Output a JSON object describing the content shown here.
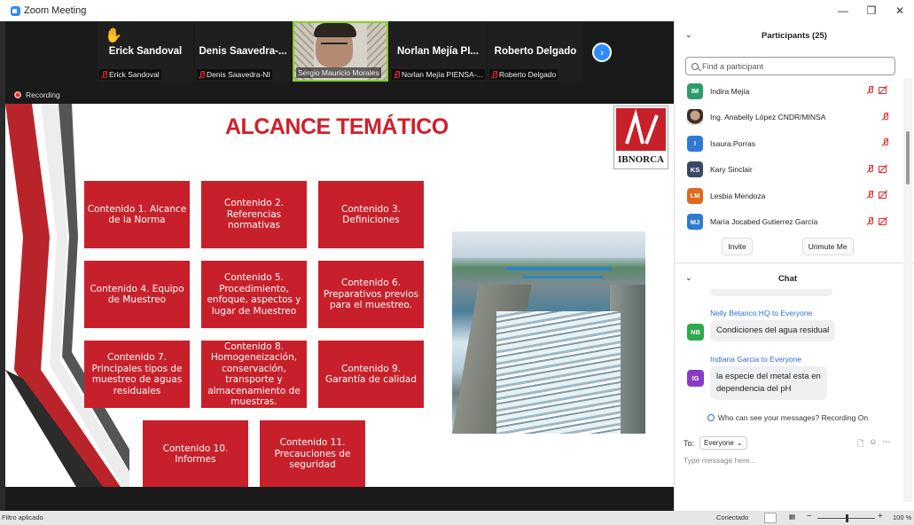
{
  "window": {
    "title": "Zoom Meeting",
    "controls": [
      "—",
      "❐",
      "✕"
    ]
  },
  "gallery": {
    "tiles": [
      {
        "big_name": "Erick Sandoval",
        "small_name": "Erick Sandoval",
        "raised_hand": "✋",
        "muted": true
      },
      {
        "big_name": "Denis  Saavedra-...",
        "small_name": "Denis Saavedra-NI",
        "muted": true
      },
      {
        "big_name": "",
        "small_name": "Sergio Mauricio Morales",
        "muted": false,
        "video": true
      },
      {
        "big_name": "Norlan  Mejía  PI...",
        "small_name": "Norlan Mejía PIENSA-...",
        "muted": true
      },
      {
        "big_name": "Roberto Delgado",
        "small_name": "Roberto Delgado",
        "muted": true
      }
    ],
    "next_icon": "chevron-right-icon",
    "next_glyph": "›"
  },
  "recording_label": "Recording",
  "slide": {
    "title": "ALCANCE TEMÁTICO",
    "logo_text": "IBNORCA",
    "boxes": [
      "Contenido 1. Alcance de la Norma",
      "Contenido 2. Referencias normativas",
      "Contenido 3. Definiciones",
      "Contenido 4. Equipo de Muestreo",
      "Contenido 5. Procedimiento, enfoque, aspectos y lugar de Muestreo",
      "Contenido 6. Preparativos previos para el muestreo.",
      "Contenido 7. Principales tipos de muestreo de aguas residuales",
      "Contenido 8. Homogeneización, conservación, transporte y almacenamiento de muestras.",
      "Contenido 9. Garantía de calidad",
      "Contenido 10. Informes",
      "Contenido 11. Precauciones de seguridad"
    ]
  },
  "participants": {
    "header": "Participants (25)",
    "search_placeholder": "Find a participant",
    "list": [
      {
        "initials": "IM",
        "name": "Indira Mejía",
        "color": "#2e9b6a",
        "video_off": true
      },
      {
        "initials": "",
        "name": "Ing. Anabelly López CNDR/MINSA",
        "color": "",
        "photo": true,
        "video_off": false
      },
      {
        "initials": "I",
        "name": "Isaura.Porras",
        "color": "#2d7ad6",
        "video_off": false
      },
      {
        "initials": "KS",
        "name": "Kary Sinclair",
        "color": "#3b4a63",
        "video_off": true
      },
      {
        "initials": "LM",
        "name": "Lesbia Mendoza",
        "color": "#e0691b",
        "video_off": true
      },
      {
        "initials": "MJ",
        "name": "María Jocabed Gutierrez García",
        "color": "#2d7ad6",
        "video_off": true
      }
    ],
    "invite_label": "Invite",
    "unmute_label": "Unmute Me"
  },
  "chat": {
    "header": "Chat",
    "messages": [
      {
        "sender": "Nelly Betanco HQ to Everyone",
        "initials": "NB",
        "color": "#2eaa4a",
        "text": "Condiciones del agua residual"
      },
      {
        "sender": "Indiana Garcia to Everyone",
        "initials": "IG",
        "color": "#8a3bc5",
        "text_lines": [
          "la especie del metal esta en",
          "dependencia del pH"
        ]
      }
    ],
    "visibility_note": "Who can see your messages? Recording On",
    "to_label": "To:",
    "to_value": "Everyone",
    "input_placeholder": "Type message here..."
  },
  "statusbar": {
    "left_text": "Filtro aplicado",
    "connection": "Conectado",
    "zoom": "100 %"
  },
  "colors": {
    "accent": "#2d8cff",
    "slide_red": "#c8202a",
    "muted_red": "#e02828"
  }
}
